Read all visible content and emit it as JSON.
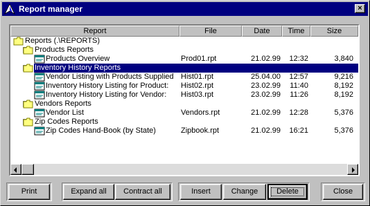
{
  "window": {
    "title": "Report manager",
    "close_glyph": "×"
  },
  "columns": [
    {
      "label": "Report"
    },
    {
      "label": "File"
    },
    {
      "label": "Date"
    },
    {
      "label": "Time"
    },
    {
      "label": "Size"
    }
  ],
  "rows": [
    {
      "level": 0,
      "kind": "folder",
      "expander": false,
      "name": "Reports (.\\REPORTS)",
      "file": "",
      "date": "",
      "time": "",
      "size": ""
    },
    {
      "level": 1,
      "kind": "folder",
      "expander": true,
      "name": "Products Reports",
      "file": "",
      "date": "",
      "time": "",
      "size": ""
    },
    {
      "level": 2,
      "kind": "report",
      "expander": false,
      "name": "Products Overview",
      "file": "Prod01.rpt",
      "date": "21.02.99",
      "time": "12:32",
      "size": "3,840"
    },
    {
      "level": 1,
      "kind": "folder",
      "expander": true,
      "selected": true,
      "name": "Inventory History Reports",
      "file": "",
      "date": "",
      "time": "",
      "size": ""
    },
    {
      "level": 2,
      "kind": "report",
      "expander": false,
      "name": "Vendor Listing with Products Supplied",
      "file": "Hist01.rpt",
      "date": "25.04.00",
      "time": "12:57",
      "size": "9,216"
    },
    {
      "level": 2,
      "kind": "report",
      "expander": false,
      "name": "Inventory History Listing for Product:",
      "file": "Hist02.rpt",
      "date": "23.02.99",
      "time": "11:40",
      "size": "8,192"
    },
    {
      "level": 2,
      "kind": "report",
      "expander": false,
      "name": "Inventory History Listing for Vendor:",
      "file": "Hist03.rpt",
      "date": "23.02.99",
      "time": "11:26",
      "size": "8,192"
    },
    {
      "level": 1,
      "kind": "folder",
      "expander": true,
      "name": "Vendors Reports",
      "file": "",
      "date": "",
      "time": "",
      "size": ""
    },
    {
      "level": 2,
      "kind": "report",
      "expander": false,
      "name": "Vendor List",
      "file": "Vendors.rpt",
      "date": "21.02.99",
      "time": "12:28",
      "size": "5,376"
    },
    {
      "level": 1,
      "kind": "folder",
      "expander": true,
      "name": "Zip Codes Reports",
      "file": "",
      "date": "",
      "time": "",
      "size": ""
    },
    {
      "level": 2,
      "kind": "report",
      "expander": false,
      "name": "Zip Codes Hand-Book (by State)",
      "file": "Zipbook.rpt",
      "date": "21.02.99",
      "time": "16:21",
      "size": "5,376"
    }
  ],
  "buttons": {
    "print": "Print",
    "expand_all": "Expand all",
    "contract_all": "Contract all",
    "insert": "Insert",
    "change": "Change",
    "delete": "Delete",
    "close": "Close"
  },
  "colors": {
    "title_bg": "#000080",
    "selection": "#000080",
    "folder": "#ffff80"
  }
}
